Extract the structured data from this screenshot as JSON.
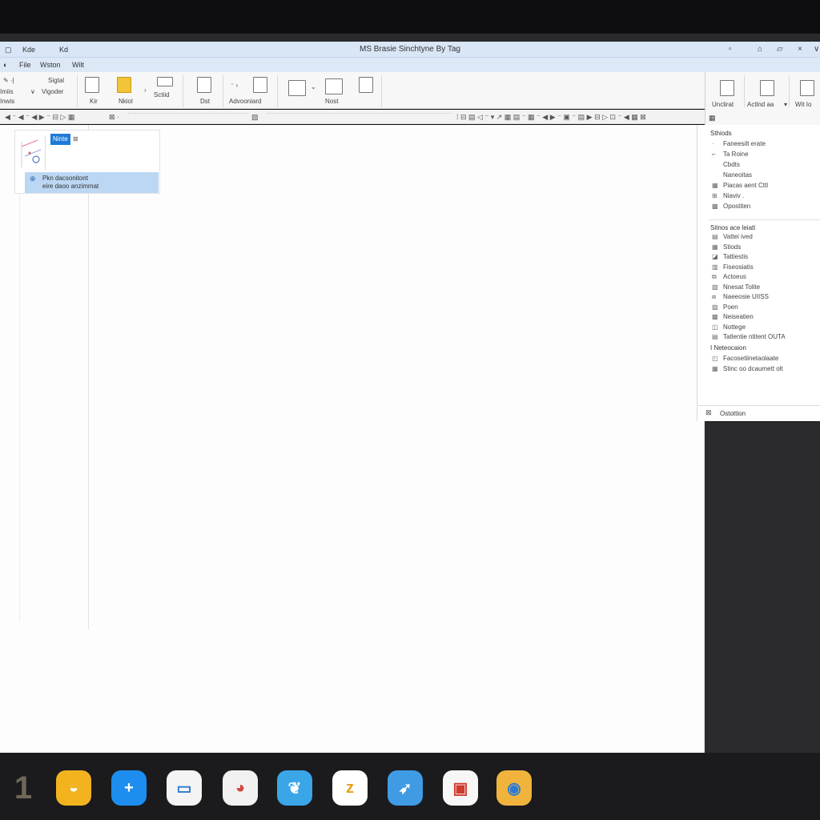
{
  "window": {
    "title": "MS Brasie Sinchtyne By Tag",
    "menu": [
      "File",
      "Wston",
      "Wilt"
    ],
    "quick": [
      "Kde",
      "Kd"
    ]
  },
  "ribbon": {
    "left_top": [
      "Sigtal",
      "Vigoder"
    ],
    "left_labels": [
      "Imiis",
      "Inwis"
    ],
    "groups": [
      {
        "label": "Kir"
      },
      {
        "label": "Nkiol"
      },
      {
        "label": "Sctiid"
      },
      {
        "label": "Dst"
      },
      {
        "label": "Advooniard"
      },
      {
        "label": "Nost"
      }
    ],
    "right_groups": [
      {
        "label": "Unclirat"
      },
      {
        "label": "Actlnd aa"
      },
      {
        "label": "Wit Io"
      }
    ]
  },
  "nav": {
    "tag": "Ninte",
    "selected_line1": "Pkn dacsonitont",
    "selected_line2": "eire daoo anzimmat"
  },
  "right_panel": {
    "header1": "Sthiods",
    "items1": [
      {
        "icon": "·",
        "label": "Faneesilt erate"
      },
      {
        "icon": "⌐",
        "label": "Ta Roine"
      },
      {
        "icon": " ",
        "label": "Cbdts"
      },
      {
        "icon": " ",
        "label": "Naneoitas"
      },
      {
        "icon": "▦",
        "label": "Piacas aent Cttl"
      },
      {
        "icon": "⊞",
        "label": "Niaviv ."
      },
      {
        "icon": "▩",
        "label": "Opostiten"
      }
    ],
    "header2": "Sitnos ace leiatl",
    "items2": [
      {
        "icon": "▤",
        "label": "Vattei ived"
      },
      {
        "icon": "▦",
        "label": "Stiods"
      },
      {
        "icon": "◪",
        "label": "Tattiestis"
      },
      {
        "icon": "▥",
        "label": "Fiseosiatis"
      },
      {
        "icon": "⧉",
        "label": "Actoeus"
      },
      {
        "icon": "▧",
        "label": "Nnesat Tolite"
      },
      {
        "icon": "⧈",
        "label": "Naeeosie UIISS"
      },
      {
        "icon": "▨",
        "label": "Poen"
      },
      {
        "icon": "▩",
        "label": "Neiseatien"
      },
      {
        "icon": "◫",
        "label": "Nottege"
      },
      {
        "icon": "▤",
        "label": "Tatlentie ntitent OUTA"
      }
    ],
    "header3": "I Neteocaion",
    "items3": [
      {
        "icon": "◰",
        "label": "Facosetiinetaolaate"
      },
      {
        "icon": "▦",
        "label": "Stinc oo dcaumett olt"
      }
    ],
    "footer": "Ostottion"
  },
  "taskbar": {
    "apps": [
      {
        "name": "digit-one",
        "glyph": "1",
        "bg": "transparent",
        "fg": "#6f6759"
      },
      {
        "name": "yellow-app",
        "glyph": "◒",
        "bg": "#f2b31f",
        "fg": "#fff"
      },
      {
        "name": "blue-plus-app",
        "glyph": "+",
        "bg": "#1d8ef0",
        "fg": "#fff"
      },
      {
        "name": "folder-app",
        "glyph": "▭",
        "bg": "#f4f4f4",
        "fg": "#2d7bd2"
      },
      {
        "name": "color-wheel-app",
        "glyph": "◕",
        "bg": "#f1f1f1",
        "fg": "#d2463a"
      },
      {
        "name": "cloud-app",
        "glyph": "❦",
        "bg": "#3aa6e8",
        "fg": "#fff"
      },
      {
        "name": "z-app",
        "glyph": "z",
        "bg": "#ffffff",
        "fg": "#e8a21a"
      },
      {
        "name": "bird-app",
        "glyph": "➶",
        "bg": "#3f9be4",
        "fg": "#fff"
      },
      {
        "name": "image-app",
        "glyph": "▣",
        "bg": "#f7f7f7",
        "fg": "#d0392d"
      },
      {
        "name": "globe-app",
        "glyph": "◉",
        "bg": "#f0b43d",
        "fg": "#2a7bd8"
      }
    ]
  },
  "colors": {
    "titlebar": "#d9e6f6",
    "selection": "#bcd7f3",
    "accent": "#1f7bd8"
  }
}
